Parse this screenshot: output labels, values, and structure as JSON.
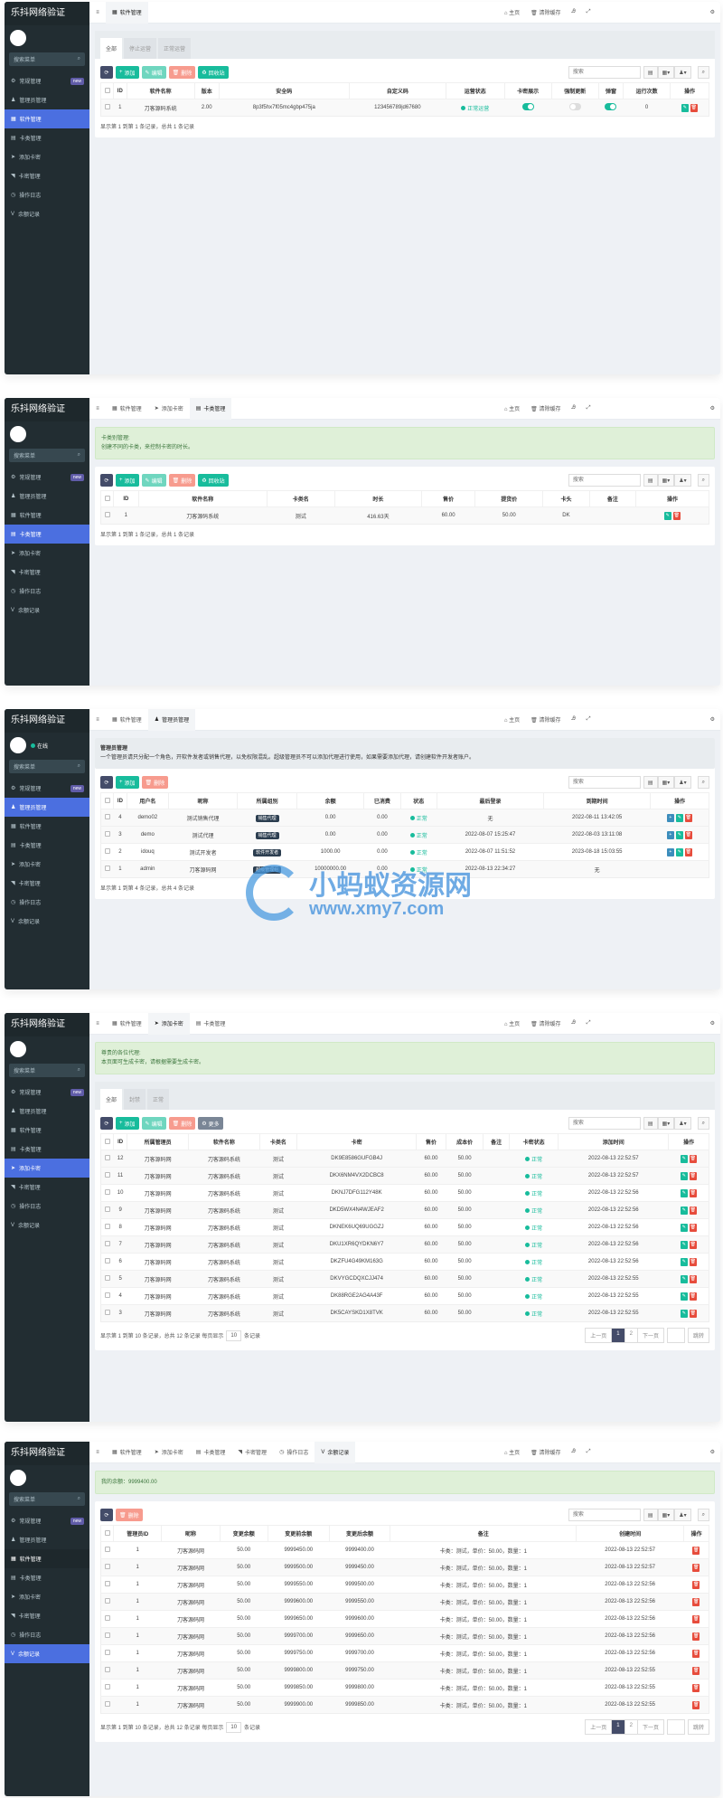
{
  "app": {
    "title": "乐抖网络验证",
    "menu_search_placeholder": "搜索菜单",
    "table_search_placeholder": "搜索",
    "home_label": "主页",
    "clear_cache_label": "清除缓存"
  },
  "sidebar_menu": [
    {
      "label": "常规管理",
      "icon": "cogs-icon",
      "badge": "new"
    },
    {
      "label": "管理员管理",
      "icon": "user-icon"
    },
    {
      "label": "软件管理",
      "icon": "table-icon"
    },
    {
      "label": "卡类管理",
      "icon": "card-icon"
    },
    {
      "label": "添加卡密",
      "icon": "send-icon"
    },
    {
      "label": "卡密管理",
      "icon": "rss-icon"
    },
    {
      "label": "操作日志",
      "icon": "clock-icon"
    },
    {
      "label": "余额记录",
      "icon": "vimeo-icon"
    }
  ],
  "colors": {
    "sidebar": "#222d32",
    "active_menu": "#4b6fe0",
    "success": "#18bc9c",
    "danger": "#e74c3c",
    "primary_dark": "#444c69"
  },
  "watermark": {
    "title": "小蚂蚁资源网",
    "url": "www.xmy7.com"
  },
  "panels": [
    {
      "active_menu": "软件管理",
      "tabs": [
        "软件管理"
      ],
      "active_tab": "软件管理",
      "subtabs": [
        "全部",
        "停止运营",
        "正常运营"
      ],
      "active_subtab": "全部",
      "toolbar": [
        {
          "label": "",
          "kind": "refresh"
        },
        {
          "label": "添加",
          "kind": "add"
        },
        {
          "label": "编辑",
          "kind": "edit"
        },
        {
          "label": "删除",
          "kind": "del"
        },
        {
          "label": "回收站",
          "kind": "recycle"
        }
      ],
      "table": {
        "columns": [
          "ID",
          "软件名称",
          "版本",
          "安全码",
          "自定义码",
          "运营状态",
          "卡密展示",
          "强制更新",
          "弹窗",
          "运行次数",
          "操作"
        ],
        "rows": [
          {
            "cells": [
              "1",
              "刀客源码系统",
              "2.00",
              "8p3f5hx7f05mc4gbp475ja",
              "123456789jd67680",
              {
                "status": "正常运营"
              },
              {
                "toggle": true
              },
              {
                "toggle": false
              },
              {
                "toggle": true
              },
              "0"
            ],
            "actions": [
              "edit",
              "delete"
            ]
          }
        ]
      },
      "footer": "显示第 1 到第 1 条记录，总共 1 条记录"
    },
    {
      "active_menu": "卡类管理",
      "tabs": [
        "软件管理",
        "添加卡密",
        "卡类管理"
      ],
      "active_tab": "卡类管理",
      "alert": {
        "type": "green",
        "title": "卡类别管理:",
        "text": "创建不同的卡类，来控制卡密的时长。"
      },
      "toolbar": [
        {
          "label": "",
          "kind": "refresh"
        },
        {
          "label": "添加",
          "kind": "add"
        },
        {
          "label": "编辑",
          "kind": "edit"
        },
        {
          "label": "删除",
          "kind": "del"
        },
        {
          "label": "回收站",
          "kind": "recycle"
        }
      ],
      "table": {
        "columns": [
          "ID",
          "软件名称",
          "卡类名",
          "时长",
          "售价",
          "提货价",
          "卡头",
          "备注",
          "操作"
        ],
        "rows": [
          {
            "cells": [
              "1",
              "刀客源码系统",
              "测试",
              "416.63天",
              "60.00",
              "50.00",
              "DK",
              ""
            ],
            "actions": [
              "edit",
              "delete"
            ]
          }
        ]
      },
      "footer": "显示第 1 到第 1 条记录，总共 1 条记录"
    },
    {
      "active_menu": "管理员管理",
      "online": "在线",
      "tabs": [
        "软件管理",
        "管理员管理"
      ],
      "active_tab": "管理员管理",
      "alert": {
        "type": "gray",
        "title": "管理员管理",
        "text": "一个管理员请只分配一个角色，开软件发者或销售代理，以免权限混乱。超级管理员不可以添加代理进行使用，如果需要添加代理，请创建软件开发者账户。"
      },
      "toolbar": [
        {
          "label": "",
          "kind": "refresh"
        },
        {
          "label": "添加",
          "kind": "add"
        },
        {
          "label": "删除",
          "kind": "del"
        }
      ],
      "table": {
        "columns": [
          "ID",
          "用户名",
          "昵称",
          "所属组别",
          "余额",
          "已消费",
          "状态",
          "最后登录",
          "到期时间",
          "操作"
        ],
        "rows": [
          {
            "cells": [
              "4",
              "demo02",
              "测试销售代理",
              {
                "badge": "销售代理"
              },
              "0.00",
              "0.00",
              {
                "status": "正常"
              },
              "无",
              "2022-08-11 13:42:05"
            ],
            "actions": [
              "detail",
              "edit",
              "delete"
            ]
          },
          {
            "cells": [
              "3",
              "demo",
              "测试代理",
              {
                "badge": "销售代理"
              },
              "0.00",
              "0.00",
              {
                "status": "正常"
              },
              "2022-08-07 15:25:47",
              "2022-08-03 13:11:08"
            ],
            "actions": [
              "detail",
              "edit",
              "delete"
            ]
          },
          {
            "cells": [
              "2",
              "idouq",
              "测试开发者",
              {
                "badge": "软件开发者"
              },
              "1000.00",
              "0.00",
              {
                "status": "正常"
              },
              "2022-08-07 11:51:52",
              "2023-08-18 15:03:55"
            ],
            "actions": [
              "detail",
              "edit",
              "delete"
            ]
          },
          {
            "cells": [
              "1",
              "admin",
              "刀客源码网",
              {
                "badge": "超级管理组"
              },
              "10000000.00",
              "0.00",
              {
                "status": "正常"
              },
              "2022-08-13 22:34:27",
              "无"
            ],
            "actions": []
          }
        ]
      },
      "footer": "显示第 1 到第 4 条记录，总共 4 条记录"
    },
    {
      "active_menu": "添加卡密",
      "tabs": [
        "软件管理",
        "添加卡密",
        "卡类管理"
      ],
      "active_tab": "添加卡密",
      "alert": {
        "type": "green",
        "title": "尊贵的各位代理:",
        "text": "本页面可生成卡密，请根据需要生成卡密。"
      },
      "subtabs": [
        "全部",
        "封禁",
        "正常"
      ],
      "active_subtab": "全部",
      "toolbar": [
        {
          "label": "",
          "kind": "refresh"
        },
        {
          "label": "添加",
          "kind": "add"
        },
        {
          "label": "编辑",
          "kind": "edit"
        },
        {
          "label": "删除",
          "kind": "del"
        },
        {
          "label": "更多",
          "kind": "more"
        }
      ],
      "table": {
        "columns": [
          "ID",
          "所属管理员",
          "软件名称",
          "卡类名",
          "卡密",
          "售价",
          "成本价",
          "备注",
          "卡密状态",
          "添加时间",
          "操作"
        ],
        "rows": [
          {
            "cells": [
              "12",
              "刀客源码网",
              "刀客源码系统",
              "测试",
              "DK9E8586GUFGB4J",
              "60.00",
              "50.00",
              "",
              {
                "status": "正常"
              },
              "2022-08-13 22:52:57"
            ],
            "actions": [
              "edit",
              "delete"
            ]
          },
          {
            "cells": [
              "11",
              "刀客源码网",
              "刀客源码系统",
              "测试",
              "DKX6NM4VX2DCBC8",
              "60.00",
              "50.00",
              "",
              {
                "status": "正常"
              },
              "2022-08-13 22:52:57"
            ],
            "actions": [
              "edit",
              "delete"
            ]
          },
          {
            "cells": [
              "10",
              "刀客源码网",
              "刀客源码系统",
              "测试",
              "DKNJ7DFG112Y48K",
              "60.00",
              "50.00",
              "",
              {
                "status": "正常"
              },
              "2022-08-13 22:52:56"
            ],
            "actions": [
              "edit",
              "delete"
            ]
          },
          {
            "cells": [
              "9",
              "刀客源码网",
              "刀客源码系统",
              "测试",
              "DKD5WX4N4WJEAF2",
              "60.00",
              "50.00",
              "",
              {
                "status": "正常"
              },
              "2022-08-13 22:52:56"
            ],
            "actions": [
              "edit",
              "delete"
            ]
          },
          {
            "cells": [
              "8",
              "刀客源码网",
              "刀客源码系统",
              "测试",
              "DKNEK6UQ69UGGZJ",
              "60.00",
              "50.00",
              "",
              {
                "status": "正常"
              },
              "2022-08-13 22:52:56"
            ],
            "actions": [
              "edit",
              "delete"
            ]
          },
          {
            "cells": [
              "7",
              "刀客源码网",
              "刀客源码系统",
              "测试",
              "DKU1XR6QYDKN6Y7",
              "60.00",
              "50.00",
              "",
              {
                "status": "正常"
              },
              "2022-08-13 22:52:56"
            ],
            "actions": [
              "edit",
              "delete"
            ]
          },
          {
            "cells": [
              "6",
              "刀客源码网",
              "刀客源码系统",
              "测试",
              "DKZFU4G49KM163G",
              "60.00",
              "50.00",
              "",
              {
                "status": "正常"
              },
              "2022-08-13 22:52:56"
            ],
            "actions": [
              "edit",
              "delete"
            ]
          },
          {
            "cells": [
              "5",
              "刀客源码网",
              "刀客源码系统",
              "测试",
              "DKVYGCDQXCJJ474",
              "60.00",
              "50.00",
              "",
              {
                "status": "正常"
              },
              "2022-08-13 22:52:55"
            ],
            "actions": [
              "edit",
              "delete"
            ]
          },
          {
            "cells": [
              "4",
              "刀客源码网",
              "刀客源码系统",
              "测试",
              "DK88RGE2AG4A43F",
              "60.00",
              "50.00",
              "",
              {
                "status": "正常"
              },
              "2022-08-13 22:52:55"
            ],
            "actions": [
              "edit",
              "delete"
            ]
          },
          {
            "cells": [
              "3",
              "刀客源码网",
              "刀客源码系统",
              "测试",
              "DK5CAYSKD1X8TVK",
              "60.00",
              "50.00",
              "",
              {
                "status": "正常"
              },
              "2022-08-13 22:52:55"
            ],
            "actions": [
              "edit",
              "delete"
            ]
          }
        ]
      },
      "footer": "显示第 1 到第 10 条记录，总共 12 条记录 每页显示",
      "page_size": "10",
      "footer_suffix": "条记录",
      "pagination": {
        "prev": "上一页",
        "pages": [
          "1",
          "2"
        ],
        "current": "1",
        "next": "下一页",
        "jump": "跳转"
      }
    },
    {
      "active_menu": "余额记录",
      "tabs": [
        "软件管理",
        "添加卡密",
        "卡类管理",
        "卡密管理",
        "操作日志",
        "余额记录"
      ],
      "active_tab": "余额记录",
      "alert": {
        "type": "green",
        "title": "",
        "text": "我的余额：9999400.00"
      },
      "toolbar": [
        {
          "label": "",
          "kind": "refresh"
        },
        {
          "label": "删除",
          "kind": "del"
        }
      ],
      "table": {
        "columns": [
          "管理员ID",
          "昵称",
          "变更余额",
          "变更前余额",
          "变更后余额",
          "备注",
          "创建时间",
          "操作"
        ],
        "rows": [
          {
            "cells": [
              "1",
              "刀客源码网",
              "50.00",
              "9999450.00",
              "9999400.00",
              "卡类：测试，单价：50.00，数量：1",
              "2022-08-13 22:52:57"
            ],
            "actions": [
              "delete"
            ]
          },
          {
            "cells": [
              "1",
              "刀客源码网",
              "50.00",
              "9999500.00",
              "9999450.00",
              "卡类：测试，单价：50.00，数量：1",
              "2022-08-13 22:52:57"
            ],
            "actions": [
              "delete"
            ]
          },
          {
            "cells": [
              "1",
              "刀客源码网",
              "50.00",
              "9999550.00",
              "9999500.00",
              "卡类：测试，单价：50.00，数量：1",
              "2022-08-13 22:52:56"
            ],
            "actions": [
              "delete"
            ]
          },
          {
            "cells": [
              "1",
              "刀客源码网",
              "50.00",
              "9999600.00",
              "9999550.00",
              "卡类：测试，单价：50.00，数量：1",
              "2022-08-13 22:52:56"
            ],
            "actions": [
              "delete"
            ]
          },
          {
            "cells": [
              "1",
              "刀客源码网",
              "50.00",
              "9999650.00",
              "9999600.00",
              "卡类：测试，单价：50.00，数量：1",
              "2022-08-13 22:52:56"
            ],
            "actions": [
              "delete"
            ]
          },
          {
            "cells": [
              "1",
              "刀客源码网",
              "50.00",
              "9999700.00",
              "9999650.00",
              "卡类：测试，单价：50.00，数量：1",
              "2022-08-13 22:52:56"
            ],
            "actions": [
              "delete"
            ]
          },
          {
            "cells": [
              "1",
              "刀客源码网",
              "50.00",
              "9999750.00",
              "9999700.00",
              "卡类：测试，单价：50.00，数量：1",
              "2022-08-13 22:52:56"
            ],
            "actions": [
              "delete"
            ]
          },
          {
            "cells": [
              "1",
              "刀客源码网",
              "50.00",
              "9999800.00",
              "9999750.00",
              "卡类：测试，单价：50.00，数量：1",
              "2022-08-13 22:52:55"
            ],
            "actions": [
              "delete"
            ]
          },
          {
            "cells": [
              "1",
              "刀客源码网",
              "50.00",
              "9999850.00",
              "9999800.00",
              "卡类：测试，单价：50.00，数量：1",
              "2022-08-13 22:52:55"
            ],
            "actions": [
              "delete"
            ]
          },
          {
            "cells": [
              "1",
              "刀客源码网",
              "50.00",
              "9999900.00",
              "9999850.00",
              "卡类：测试，单价：50.00，数量：1",
              "2022-08-13 22:52:55"
            ],
            "actions": [
              "delete"
            ]
          }
        ]
      },
      "footer": "显示第 1 到第 10 条记录，总共 12 条记录 每页显示",
      "page_size": "10",
      "footer_suffix": "条记录",
      "pagination": {
        "prev": "上一页",
        "pages": [
          "1",
          "2"
        ],
        "current": "1",
        "next": "下一页",
        "jump": "跳转"
      }
    }
  ]
}
